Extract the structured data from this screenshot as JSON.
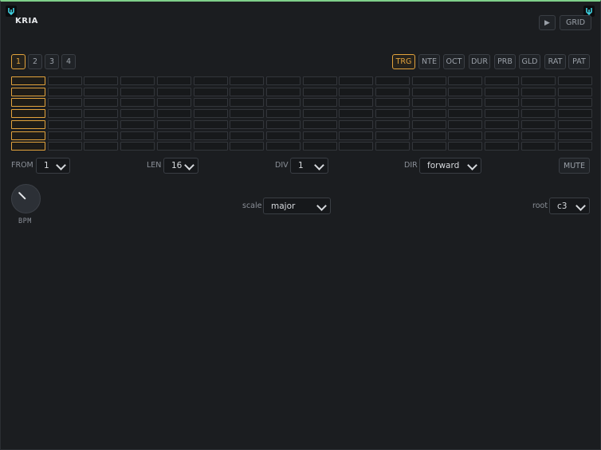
{
  "app": {
    "title": "KRIA"
  },
  "header": {
    "play_label": "▶",
    "grid_label": "GRID"
  },
  "tracks": [
    "1",
    "2",
    "3",
    "4"
  ],
  "active_track": 0,
  "modes": [
    "TRG",
    "NTE",
    "OCT",
    "DUR",
    "PRB",
    "GLD",
    "RAT",
    "PAT"
  ],
  "active_mode": 0,
  "grid": {
    "rows": 7,
    "cols": 16,
    "on_col": 0
  },
  "controls": {
    "from_label": "FROM",
    "from_value": "1",
    "len_label": "LEN",
    "len_value": "16",
    "div_label": "DIV",
    "div_value": "1",
    "dir_label": "DIR",
    "dir_value": "forward",
    "mute_label": "MUTE"
  },
  "bpm": {
    "label": "BPM"
  },
  "scale": {
    "label": "scale",
    "value": "major"
  },
  "root": {
    "label": "root",
    "value": "c3"
  },
  "colors": {
    "accent": "#e3a33c",
    "top_border": "#7fd08a",
    "logo_glyph": "#3fd0e0"
  }
}
